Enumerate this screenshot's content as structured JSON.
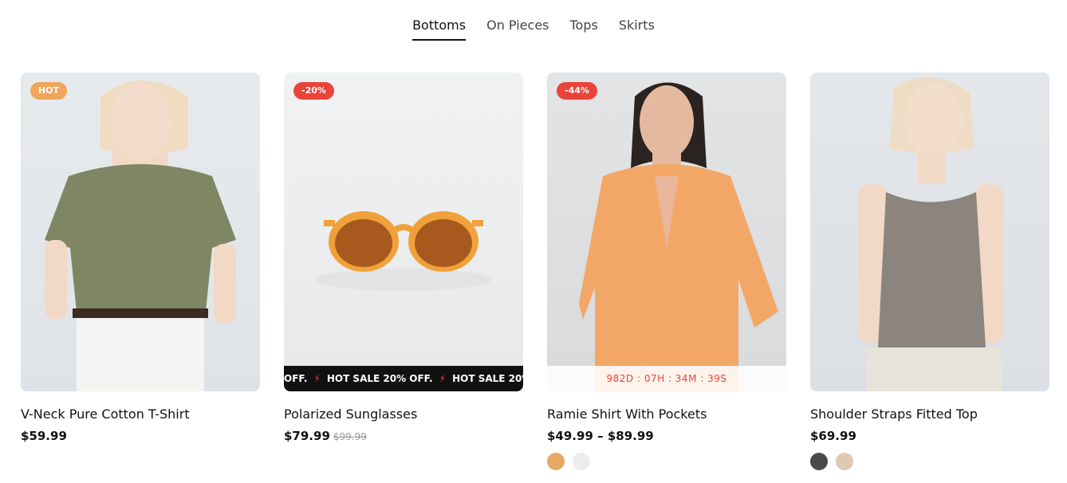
{
  "tabs": [
    "Bottoms",
    "On Pieces",
    "Tops",
    "Skirts"
  ],
  "products": [
    {
      "name": "V-Neck Pure Cotton T-Shirt",
      "price": "$59.99",
      "badge": "HOT"
    },
    {
      "name": "Polarized Sunglasses",
      "price": "$79.99",
      "old_price": "$99.99",
      "badge": "-20%",
      "marquee": [
        "OFF.",
        "HOT SALE 20% OFF.",
        "HOT SALE 20%"
      ]
    },
    {
      "name": "Ramie Shirt With Pockets",
      "price": "$49.99 – $89.99",
      "badge": "-44%",
      "countdown": "982D : 07H : 34M : 39S",
      "swatches": [
        "#e8a865",
        "#ececec"
      ]
    },
    {
      "name": "Shoulder Straps Fitted Top",
      "price": "$69.99",
      "swatches": [
        "#4a4a4a",
        "#dfc9b5"
      ]
    }
  ],
  "colors": {
    "hot_badge": "#f0a55a",
    "sale_badge": "#e8443a",
    "countdown": "#e8443a"
  }
}
